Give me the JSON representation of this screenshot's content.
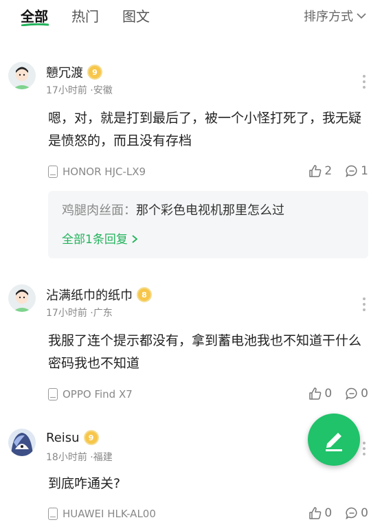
{
  "colors": {
    "accent": "#22b35c",
    "fab": "#20c26a",
    "level_badge": "#f7c64a"
  },
  "tabs": [
    {
      "label": "全部",
      "active": true
    },
    {
      "label": "热门",
      "active": false
    },
    {
      "label": "图文",
      "active": false
    }
  ],
  "sort": {
    "label": "排序方式",
    "icon": "chevron-down-icon"
  },
  "comments": [
    {
      "username": "戅冗渡",
      "level": "9",
      "meta": "17小时前 ·安徽",
      "text": "嗯，对，就是打到最后了，被一个小怪打死了，我无疑是愤怒的，而且没有存档",
      "device": "HONOR HJC-LX9",
      "likes": "2",
      "replies": "1",
      "reply": {
        "author": "鸡腿肉丝面：",
        "text": "那个彩色电视机那里怎么过",
        "more": "全部1条回复"
      }
    },
    {
      "username": "沾满纸巾的纸巾",
      "level": "8",
      "meta": "17小时前 ·广东",
      "text": "我服了连个提示都没有，拿到蓄电池我也不知道干什么密码我也不知道",
      "device": "OPPO Find X7",
      "likes": "0",
      "replies": "0"
    },
    {
      "username": "Reisu",
      "level": "9",
      "meta": "18小时前 ·福建",
      "text": "到底咋通关?",
      "device": "HUAWEI HLK-AL00",
      "likes": "0",
      "replies": "0"
    }
  ],
  "fab": {
    "icon": "edit-pencil-icon"
  }
}
